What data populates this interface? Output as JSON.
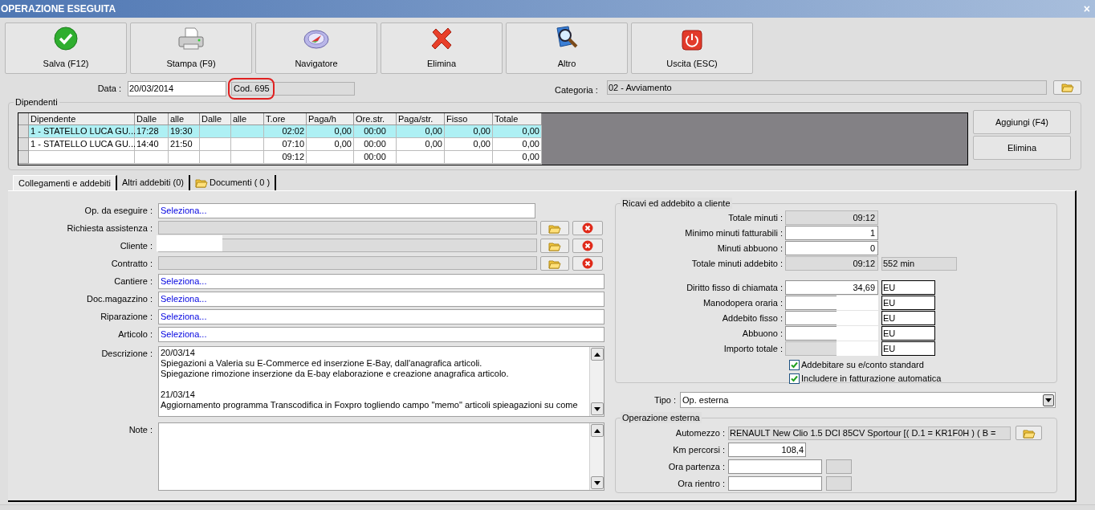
{
  "window": {
    "title": "OPERAZIONE ESEGUITA",
    "close": "×"
  },
  "toolbar": [
    {
      "label": "Salva (F12)",
      "kind": "save"
    },
    {
      "label": "Stampa (F9)",
      "kind": "print"
    },
    {
      "label": "Navigatore",
      "kind": "navigator"
    },
    {
      "label": "Elimina",
      "kind": "delete"
    },
    {
      "label": "Altro",
      "kind": "more"
    },
    {
      "label": "Uscita (ESC)",
      "kind": "exit"
    }
  ],
  "header": {
    "date_label": "Data :",
    "date": "20/03/2014",
    "code": "Cod. 695",
    "code_highlighted": true,
    "category_label": "Categoria :",
    "category": "02 - Avviamento"
  },
  "employees": {
    "title": "Dipendenti",
    "columns": [
      "Dipendente",
      "Dalle",
      "alle",
      "Dalle",
      "alle",
      "T.ore",
      "Paga/h",
      "Ore.str.",
      "Paga/str.",
      "Fisso",
      "Totale"
    ],
    "rows": [
      {
        "selected": true,
        "cells": [
          "1 - STATELLO LUCA GU...",
          "17:28",
          "19:30",
          "",
          "",
          "02:02",
          "0,00",
          "00:00",
          "0,00",
          "0,00",
          "0,00"
        ]
      },
      {
        "selected": false,
        "cells": [
          "1 - STATELLO LUCA GU...",
          "14:40",
          "21:50",
          "",
          "",
          "07:10",
          "0,00",
          "00:00",
          "0,00",
          "0,00",
          "0,00"
        ]
      },
      {
        "selected": false,
        "cells": [
          "",
          "",
          "",
          "",
          "",
          "09:12",
          "",
          "00:00",
          "",
          "",
          "0,00"
        ]
      }
    ],
    "buttons": [
      "Aggiungi (F4)",
      "Elimina"
    ]
  },
  "tabs": [
    {
      "label": "Collegamenti e addebiti",
      "selected": true,
      "icon": false
    },
    {
      "label": "Altri addebiti (0)",
      "selected": false,
      "icon": false
    },
    {
      "label": "Documenti ( 0 )",
      "selected": false,
      "icon": true
    }
  ],
  "links": [
    {
      "kind": "picker",
      "label": "Op. da eseguire :",
      "value": "Seleziona..."
    },
    {
      "kind": "lookup",
      "label": "Richiesta assistenza :"
    },
    {
      "kind": "lookup",
      "label": "Cliente :"
    },
    {
      "kind": "lookup",
      "label": "Contratto :"
    },
    {
      "kind": "picker",
      "label": "Cantiere :",
      "value": "Seleziona..."
    },
    {
      "kind": "picker",
      "label": "Doc.magazzino :",
      "value": "Seleziona..."
    },
    {
      "kind": "picker",
      "label": "Riparazione :",
      "value": "Seleziona..."
    },
    {
      "kind": "picker",
      "label": "Articolo :",
      "value": "Seleziona..."
    },
    {
      "kind": "memo",
      "label": "Descrizione :",
      "value": "20/03/14\nSpiegazioni a Valeria su E-Commerce ed inserzione E-Bay, dall'anagrafica articoli.\nSpiegazione rimozione inserzione da E-bay elaborazione e creazione anagrafica articolo.\n\n21/03/14\nAggiornamento programma Transcodifica in Foxpro togliendo campo \"memo\" articoli spieagazioni su come"
    },
    {
      "kind": "memo",
      "label": "Note :"
    }
  ],
  "revenue": {
    "title": "Ricavi ed addebito a cliente",
    "rows": [
      {
        "readonly": true,
        "label": "Totale minuti :",
        "value": "09:12"
      },
      {
        "readonly": false,
        "label": "Minimo minuti fatturabili :",
        "value": "1"
      },
      {
        "readonly": false,
        "label": "Minuti abbuono :",
        "value": "0"
      },
      {
        "readonly": true,
        "label": "Totale minuti addebito :",
        "value": "09:12",
        "extra": "552 min"
      }
    ],
    "amounts": [
      {
        "readonly": false,
        "label": "Diritto fisso di chiamata :",
        "value": "34,69",
        "currency": "EU"
      },
      {
        "readonly": false,
        "label": "Manodopera oraria :",
        "currency": "EU"
      },
      {
        "readonly": false,
        "label": "Addebito fisso :",
        "currency": "EU"
      },
      {
        "readonly": false,
        "label": "Abbuono :",
        "currency": "EU"
      },
      {
        "readonly": true,
        "label": "Importo totale :",
        "currency": "EU"
      }
    ],
    "checks": [
      {
        "label": "Addebitare su e/conto standard",
        "checked": true
      },
      {
        "label": "Includere in fatturazione automatica",
        "checked": true
      }
    ]
  },
  "type": {
    "label": "Tipo :",
    "value": "Op. esterna"
  },
  "external": {
    "title": "Operazione esterna",
    "vehicle_label": "Automezzo :",
    "vehicle": "RENAULT New Clio 1.5 DCI 85CV Sportour [( D.1 = KR1F0H ) ( B =",
    "km_label": "Km percorsi :",
    "km": "108,4",
    "departure_label": "Ora partenza :",
    "return_label": "Ora rientro :"
  }
}
